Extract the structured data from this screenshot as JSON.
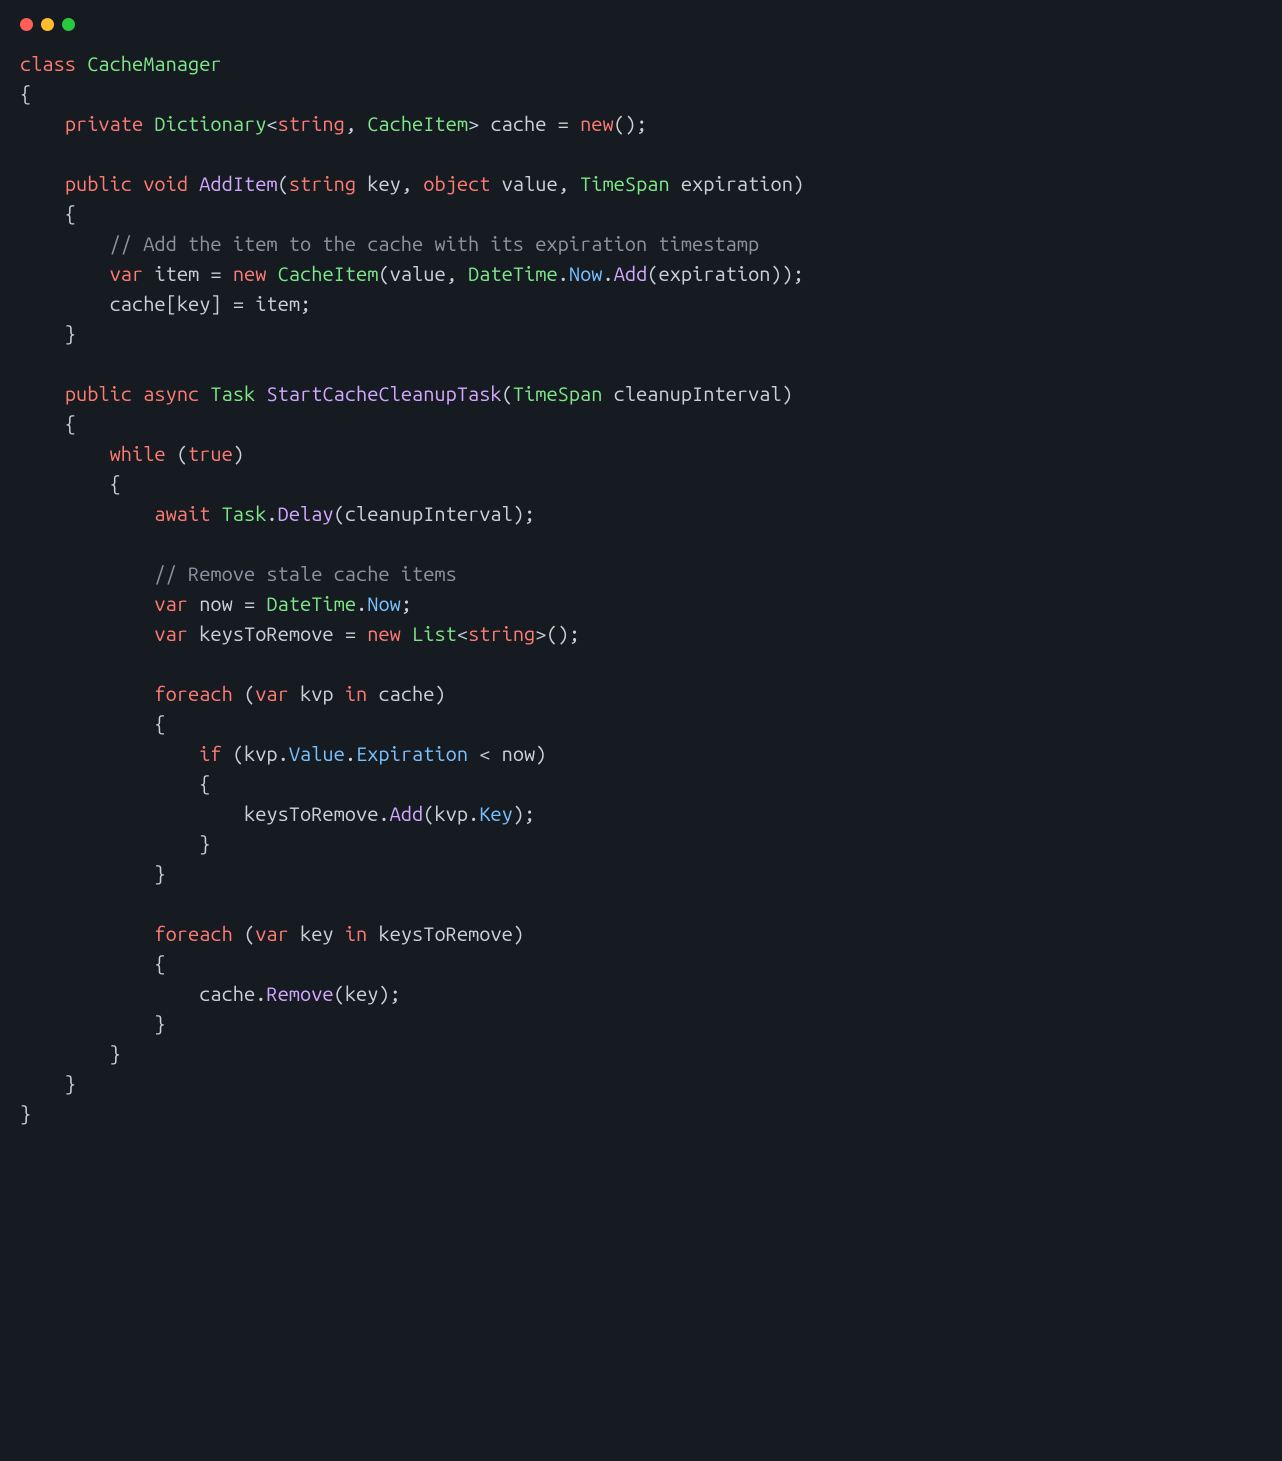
{
  "window": {
    "dots": [
      "red",
      "yellow",
      "green"
    ]
  },
  "code": {
    "tokens": [
      [
        {
          "c": "kw",
          "t": "class"
        },
        {
          "c": "pun",
          "t": " "
        },
        {
          "c": "cls",
          "t": "CacheManager"
        }
      ],
      [
        {
          "c": "pun",
          "t": "{"
        }
      ],
      [
        {
          "c": "pun",
          "t": "    "
        },
        {
          "c": "kw",
          "t": "private"
        },
        {
          "c": "pun",
          "t": " "
        },
        {
          "c": "cls",
          "t": "Dictionary"
        },
        {
          "c": "pun",
          "t": "<"
        },
        {
          "c": "kw",
          "t": "string"
        },
        {
          "c": "pun",
          "t": ", "
        },
        {
          "c": "cls",
          "t": "CacheItem"
        },
        {
          "c": "pun",
          "t": "> "
        },
        {
          "c": "ident",
          "t": "cache "
        },
        {
          "c": "pun",
          "t": "= "
        },
        {
          "c": "kw",
          "t": "new"
        },
        {
          "c": "pun",
          "t": "();"
        }
      ],
      [],
      [
        {
          "c": "pun",
          "t": "    "
        },
        {
          "c": "kw",
          "t": "public"
        },
        {
          "c": "pun",
          "t": " "
        },
        {
          "c": "kw",
          "t": "void"
        },
        {
          "c": "pun",
          "t": " "
        },
        {
          "c": "fn",
          "t": "AddItem"
        },
        {
          "c": "pun",
          "t": "("
        },
        {
          "c": "kw",
          "t": "string"
        },
        {
          "c": "pun",
          "t": " "
        },
        {
          "c": "ident",
          "t": "key"
        },
        {
          "c": "pun",
          "t": ", "
        },
        {
          "c": "kw",
          "t": "object"
        },
        {
          "c": "pun",
          "t": " "
        },
        {
          "c": "ident",
          "t": "value"
        },
        {
          "c": "pun",
          "t": ", "
        },
        {
          "c": "cls",
          "t": "TimeSpan"
        },
        {
          "c": "pun",
          "t": " "
        },
        {
          "c": "ident",
          "t": "expiration"
        },
        {
          "c": "pun",
          "t": ")"
        }
      ],
      [
        {
          "c": "pun",
          "t": "    {"
        }
      ],
      [
        {
          "c": "pun",
          "t": "        "
        },
        {
          "c": "cmt",
          "t": "// Add the item to the cache with its expiration timestamp"
        }
      ],
      [
        {
          "c": "pun",
          "t": "        "
        },
        {
          "c": "kw",
          "t": "var"
        },
        {
          "c": "pun",
          "t": " "
        },
        {
          "c": "ident",
          "t": "item "
        },
        {
          "c": "pun",
          "t": "= "
        },
        {
          "c": "kw",
          "t": "new"
        },
        {
          "c": "pun",
          "t": " "
        },
        {
          "c": "cls",
          "t": "CacheItem"
        },
        {
          "c": "pun",
          "t": "("
        },
        {
          "c": "ident",
          "t": "value"
        },
        {
          "c": "pun",
          "t": ", "
        },
        {
          "c": "cls",
          "t": "DateTime"
        },
        {
          "c": "pun",
          "t": "."
        },
        {
          "c": "prop",
          "t": "Now"
        },
        {
          "c": "pun",
          "t": "."
        },
        {
          "c": "fn",
          "t": "Add"
        },
        {
          "c": "pun",
          "t": "("
        },
        {
          "c": "ident",
          "t": "expiration"
        },
        {
          "c": "pun",
          "t": "));"
        }
      ],
      [
        {
          "c": "pun",
          "t": "        "
        },
        {
          "c": "ident",
          "t": "cache"
        },
        {
          "c": "pun",
          "t": "["
        },
        {
          "c": "ident",
          "t": "key"
        },
        {
          "c": "pun",
          "t": "] = "
        },
        {
          "c": "ident",
          "t": "item"
        },
        {
          "c": "pun",
          "t": ";"
        }
      ],
      [
        {
          "c": "pun",
          "t": "    }"
        }
      ],
      [],
      [
        {
          "c": "pun",
          "t": "    "
        },
        {
          "c": "kw",
          "t": "public"
        },
        {
          "c": "pun",
          "t": " "
        },
        {
          "c": "kw",
          "t": "async"
        },
        {
          "c": "pun",
          "t": " "
        },
        {
          "c": "cls",
          "t": "Task"
        },
        {
          "c": "pun",
          "t": " "
        },
        {
          "c": "fn",
          "t": "StartCacheCleanupTask"
        },
        {
          "c": "pun",
          "t": "("
        },
        {
          "c": "cls",
          "t": "TimeSpan"
        },
        {
          "c": "pun",
          "t": " "
        },
        {
          "c": "ident",
          "t": "cleanupInterval"
        },
        {
          "c": "pun",
          "t": ")"
        }
      ],
      [
        {
          "c": "pun",
          "t": "    {"
        }
      ],
      [
        {
          "c": "pun",
          "t": "        "
        },
        {
          "c": "kw",
          "t": "while"
        },
        {
          "c": "pun",
          "t": " ("
        },
        {
          "c": "kw",
          "t": "true"
        },
        {
          "c": "pun",
          "t": ")"
        }
      ],
      [
        {
          "c": "pun",
          "t": "        {"
        }
      ],
      [
        {
          "c": "pun",
          "t": "            "
        },
        {
          "c": "kw",
          "t": "await"
        },
        {
          "c": "pun",
          "t": " "
        },
        {
          "c": "cls",
          "t": "Task"
        },
        {
          "c": "pun",
          "t": "."
        },
        {
          "c": "fn",
          "t": "Delay"
        },
        {
          "c": "pun",
          "t": "("
        },
        {
          "c": "ident",
          "t": "cleanupInterval"
        },
        {
          "c": "pun",
          "t": ");"
        }
      ],
      [],
      [
        {
          "c": "pun",
          "t": "            "
        },
        {
          "c": "cmt",
          "t": "// Remove stale cache items"
        }
      ],
      [
        {
          "c": "pun",
          "t": "            "
        },
        {
          "c": "kw",
          "t": "var"
        },
        {
          "c": "pun",
          "t": " "
        },
        {
          "c": "ident",
          "t": "now "
        },
        {
          "c": "pun",
          "t": "= "
        },
        {
          "c": "cls",
          "t": "DateTime"
        },
        {
          "c": "pun",
          "t": "."
        },
        {
          "c": "prop",
          "t": "Now"
        },
        {
          "c": "pun",
          "t": ";"
        }
      ],
      [
        {
          "c": "pun",
          "t": "            "
        },
        {
          "c": "kw",
          "t": "var"
        },
        {
          "c": "pun",
          "t": " "
        },
        {
          "c": "ident",
          "t": "keysToRemove "
        },
        {
          "c": "pun",
          "t": "= "
        },
        {
          "c": "kw",
          "t": "new"
        },
        {
          "c": "pun",
          "t": " "
        },
        {
          "c": "cls",
          "t": "List"
        },
        {
          "c": "pun",
          "t": "<"
        },
        {
          "c": "kw",
          "t": "string"
        },
        {
          "c": "pun",
          "t": ">();"
        }
      ],
      [],
      [
        {
          "c": "pun",
          "t": "            "
        },
        {
          "c": "kw",
          "t": "foreach"
        },
        {
          "c": "pun",
          "t": " ("
        },
        {
          "c": "kw",
          "t": "var"
        },
        {
          "c": "pun",
          "t": " "
        },
        {
          "c": "ident",
          "t": "kvp "
        },
        {
          "c": "kw",
          "t": "in"
        },
        {
          "c": "pun",
          "t": " "
        },
        {
          "c": "ident",
          "t": "cache"
        },
        {
          "c": "pun",
          "t": ")"
        }
      ],
      [
        {
          "c": "pun",
          "t": "            {"
        }
      ],
      [
        {
          "c": "pun",
          "t": "                "
        },
        {
          "c": "kw",
          "t": "if"
        },
        {
          "c": "pun",
          "t": " ("
        },
        {
          "c": "ident",
          "t": "kvp"
        },
        {
          "c": "pun",
          "t": "."
        },
        {
          "c": "prop",
          "t": "Value"
        },
        {
          "c": "pun",
          "t": "."
        },
        {
          "c": "prop",
          "t": "Expiration"
        },
        {
          "c": "pun",
          "t": " < "
        },
        {
          "c": "ident",
          "t": "now"
        },
        {
          "c": "pun",
          "t": ")"
        }
      ],
      [
        {
          "c": "pun",
          "t": "                {"
        }
      ],
      [
        {
          "c": "pun",
          "t": "                    "
        },
        {
          "c": "ident",
          "t": "keysToRemove"
        },
        {
          "c": "pun",
          "t": "."
        },
        {
          "c": "fn",
          "t": "Add"
        },
        {
          "c": "pun",
          "t": "("
        },
        {
          "c": "ident",
          "t": "kvp"
        },
        {
          "c": "pun",
          "t": "."
        },
        {
          "c": "prop",
          "t": "Key"
        },
        {
          "c": "pun",
          "t": ");"
        }
      ],
      [
        {
          "c": "pun",
          "t": "                }"
        }
      ],
      [
        {
          "c": "pun",
          "t": "            }"
        }
      ],
      [],
      [
        {
          "c": "pun",
          "t": "            "
        },
        {
          "c": "kw",
          "t": "foreach"
        },
        {
          "c": "pun",
          "t": " ("
        },
        {
          "c": "kw",
          "t": "var"
        },
        {
          "c": "pun",
          "t": " "
        },
        {
          "c": "ident",
          "t": "key "
        },
        {
          "c": "kw",
          "t": "in"
        },
        {
          "c": "pun",
          "t": " "
        },
        {
          "c": "ident",
          "t": "keysToRemove"
        },
        {
          "c": "pun",
          "t": ")"
        }
      ],
      [
        {
          "c": "pun",
          "t": "            {"
        }
      ],
      [
        {
          "c": "pun",
          "t": "                "
        },
        {
          "c": "ident",
          "t": "cache"
        },
        {
          "c": "pun",
          "t": "."
        },
        {
          "c": "fn",
          "t": "Remove"
        },
        {
          "c": "pun",
          "t": "("
        },
        {
          "c": "ident",
          "t": "key"
        },
        {
          "c": "pun",
          "t": ");"
        }
      ],
      [
        {
          "c": "pun",
          "t": "            }"
        }
      ],
      [
        {
          "c": "pun",
          "t": "        }"
        }
      ],
      [
        {
          "c": "pun",
          "t": "    }"
        }
      ],
      [
        {
          "c": "pun",
          "t": "}"
        }
      ]
    ]
  }
}
